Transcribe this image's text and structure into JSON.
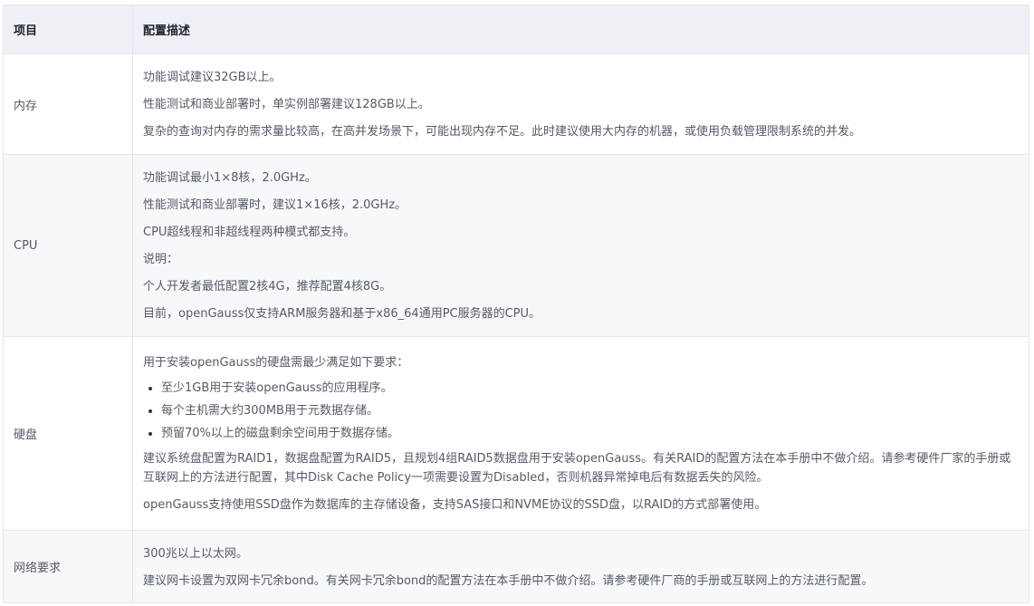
{
  "header": {
    "col_item": "项目",
    "col_desc": "配置描述"
  },
  "rows": [
    {
      "item": "内存",
      "lines": [
        "功能调试建议32GB以上。",
        "性能测试和商业部署时，单实例部署建议128GB以上。",
        "复杂的查询对内存的需求量比较高，在高并发场景下，可能出现内存不足。此时建议使用大内存的机器，或使用负载管理限制系统的并发。"
      ]
    },
    {
      "item": "CPU",
      "lines": [
        "功能调试最小1×8核，2.0GHz。",
        "性能测试和商业部署时，建议1×16核，2.0GHz。",
        "CPU超线程和非超线程两种模式都支持。",
        "说明：",
        "个人开发者最低配置2核4G，推荐配置4核8G。",
        "目前，openGauss仅支持ARM服务器和基于x86_64通用PC服务器的CPU。"
      ]
    },
    {
      "item": "硬盘",
      "intro": "用于安装openGauss的硬盘需最少满足如下要求：",
      "bullets": [
        "至少1GB用于安装openGauss的应用程序。",
        "每个主机需大约300MB用于元数据存储。",
        "预留70%以上的磁盘剩余空间用于数据存储。"
      ],
      "para1": "建议系统盘配置为RAID1，数据盘配置为RAID5，且规划4组RAID5数据盘用于安装openGauss。有关RAID的配置方法在本手册中不做介绍。请参考硬件厂家的手册或互联网上的方法进行配置，其中Disk Cache Policy一项需要设置为Disabled，否则机器异常掉电后有数据丢失的风险。",
      "para2": "openGauss支持使用SSD盘作为数据库的主存储设备，支持SAS接口和NVME协议的SSD盘，以RAID的方式部署使用。"
    },
    {
      "item": "网络要求",
      "lines": [
        "300兆以上以太网。",
        "建议网卡设置为双网卡冗余bond。有关网卡冗余bond的配置方法在本手册中不做介绍。请参考硬件厂商的手册或互联网上的方法进行配置。"
      ]
    }
  ]
}
